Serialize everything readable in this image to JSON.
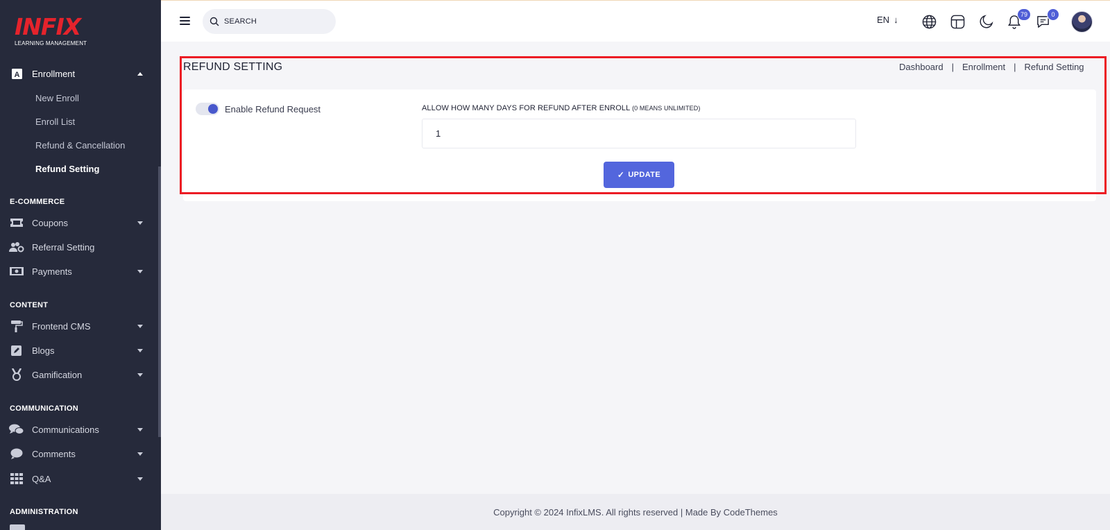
{
  "brand": {
    "logo": "INFIX",
    "subtitle": "LEARNING MANAGEMENT"
  },
  "sidebar": {
    "enrollment": {
      "label": "Enrollment",
      "icon": "enrollment-icon"
    },
    "sub_items": [
      "New Enroll",
      "Enroll List",
      "Refund & Cancellation",
      "Refund Setting"
    ],
    "sections": {
      "ecommerce": "E-COMMERCE",
      "content": "CONTENT",
      "communication": "COMMUNICATION",
      "administration": "ADMINISTRATION"
    },
    "items": {
      "coupons": "Coupons",
      "referral": "Referral Setting",
      "payments": "Payments",
      "frontend_cms": "Frontend CMS",
      "blogs": "Blogs",
      "gamification": "Gamification",
      "communications": "Communications",
      "comments": "Comments",
      "qa": "Q&A"
    }
  },
  "topbar": {
    "search_placeholder": "SEARCH",
    "language": "EN",
    "notifications_count": "79",
    "messages_count": "0"
  },
  "page": {
    "title": "REFUND SETTING",
    "breadcrumb": [
      "Dashboard",
      "Enrollment",
      "Refund Setting"
    ],
    "breadcrumb_sep": "|"
  },
  "form": {
    "toggle_label": "Enable Refund Request",
    "toggle_on": true,
    "days_label": "ALLOW HOW MANY DAYS FOR REFUND AFTER ENROLL",
    "days_hint": "(0 MEANS UNLIMITED)",
    "days_value": "1",
    "update_label": "UPDATE",
    "update_icon": "✓"
  },
  "footer": {
    "text": "Copyright © 2024 InfixLMS. All rights reserved | Made By CodeThemes"
  },
  "colors": {
    "sidebar": "#262a3b",
    "accent": "#5366dd",
    "highlight": "#ec1c24",
    "logo": "#e5232c"
  }
}
